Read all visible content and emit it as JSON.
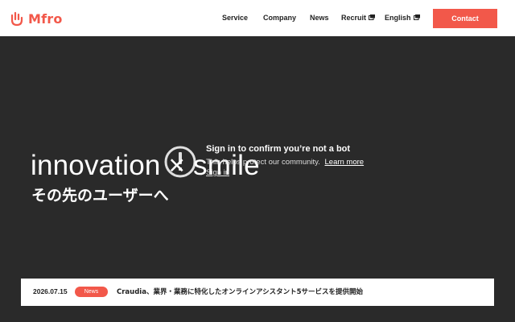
{
  "brand": {
    "name": "Mfro",
    "color": "#f2584a"
  },
  "nav": {
    "items": [
      {
        "label": "Service",
        "external": false
      },
      {
        "label": "Company",
        "external": false
      },
      {
        "label": "News",
        "external": false
      },
      {
        "label": "Recruit",
        "external": true
      },
      {
        "label": "English",
        "external": true
      }
    ],
    "contact_label": "Contact"
  },
  "hero": {
    "title": "innovation × smile",
    "subtitle": "その先のユーザーへ"
  },
  "bot_check": {
    "title": "Sign in to confirm you’re not a bot",
    "text": "This helps protect our community.",
    "learn_more": "Learn more",
    "sign_in": "Sign in"
  },
  "news": {
    "date": "2026.07.15",
    "badge": "News",
    "headline": "Craudia、業界・業務に特化したオンラインアシスタント5サービスを提供開始"
  },
  "icons": {
    "logo": "hand-logo-icon",
    "external": "external-window-icon",
    "alert": "alert-circle-icon"
  }
}
